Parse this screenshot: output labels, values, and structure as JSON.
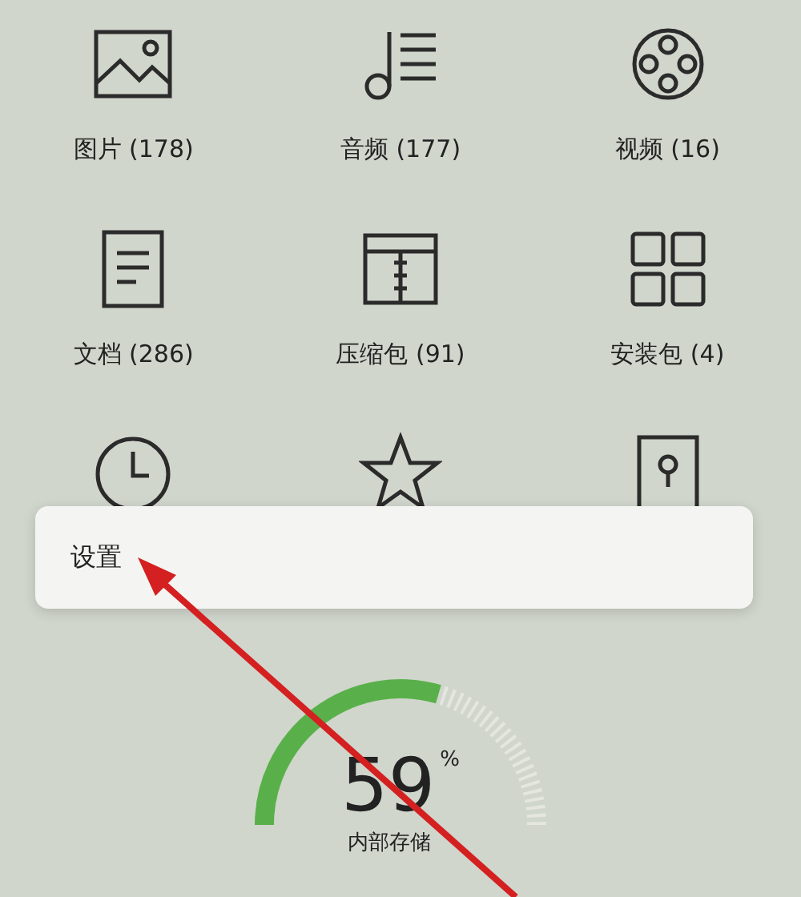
{
  "categories": [
    {
      "label": "图片 (178)"
    },
    {
      "label": "音频 (177)"
    },
    {
      "label": "视频 (16)"
    },
    {
      "label": "文档 (286)"
    },
    {
      "label": "压缩包 (91)"
    },
    {
      "label": "安装包 (4)"
    }
  ],
  "popup_menu": {
    "items": [
      {
        "label": "设置"
      }
    ]
  },
  "storage": {
    "level": 0.59,
    "value": "59",
    "unit": "%",
    "label": "内部存储"
  }
}
